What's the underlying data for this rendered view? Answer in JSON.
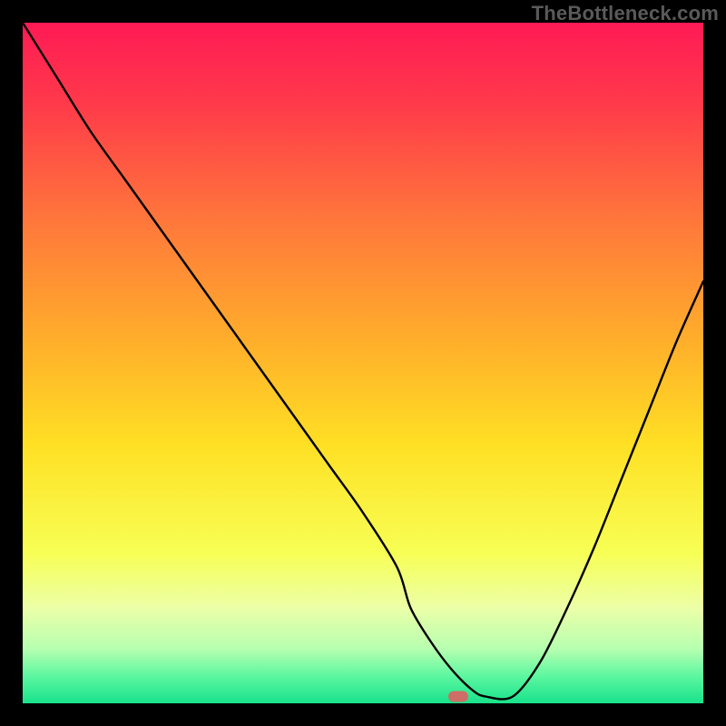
{
  "watermark": "TheBottleneck.com",
  "chart_data": {
    "type": "line",
    "title": "",
    "xlabel": "",
    "ylabel": "",
    "xlim": [
      0,
      100
    ],
    "ylim": [
      0,
      100
    ],
    "series": [
      {
        "name": "bottleneck-curve",
        "x": [
          0,
          5,
          10,
          15,
          20,
          25,
          30,
          35,
          40,
          45,
          50,
          55,
          57,
          60,
          63,
          66,
          68,
          72,
          76,
          80,
          84,
          88,
          92,
          96,
          100
        ],
        "y": [
          100,
          92,
          84,
          77,
          70,
          63,
          56,
          49,
          42,
          35,
          28,
          20,
          14,
          9,
          5,
          2,
          1,
          1,
          6,
          14,
          23,
          33,
          43,
          53,
          62
        ]
      }
    ],
    "flat_band": {
      "from_x": 60,
      "to_x": 68,
      "y": 1
    },
    "marker": {
      "x": 64,
      "y": 1,
      "color": "#cf6e66"
    },
    "background_gradient": {
      "stops": [
        {
          "offset": 0.0,
          "color": "#ff1a55"
        },
        {
          "offset": 0.12,
          "color": "#ff3a4a"
        },
        {
          "offset": 0.3,
          "color": "#ff7a3a"
        },
        {
          "offset": 0.48,
          "color": "#ffb22a"
        },
        {
          "offset": 0.62,
          "color": "#ffe024"
        },
        {
          "offset": 0.78,
          "color": "#f7ff55"
        },
        {
          "offset": 0.86,
          "color": "#ecffa8"
        },
        {
          "offset": 0.92,
          "color": "#b6ffb0"
        },
        {
          "offset": 0.96,
          "color": "#5cf7a0"
        },
        {
          "offset": 1.0,
          "color": "#18e28b"
        }
      ]
    }
  }
}
